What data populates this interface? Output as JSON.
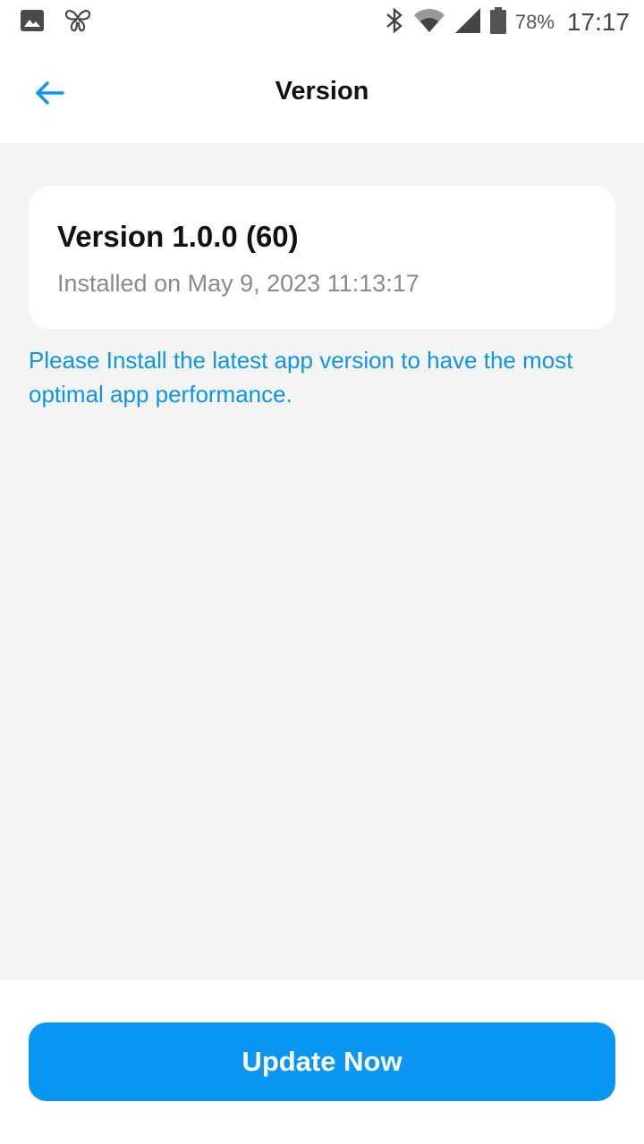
{
  "status_bar": {
    "icons_left": [
      "image-icon",
      "butterfly-icon"
    ],
    "icons_right": [
      "bluetooth-icon",
      "wifi-icon",
      "signal-icon",
      "battery-icon"
    ],
    "battery": "78%",
    "time": "17:17"
  },
  "header": {
    "title": "Version",
    "back_icon": "arrow-left-icon"
  },
  "version_card": {
    "title": "Version 1.0.0 (60)",
    "installed": "Installed on May 9, 2023 11:13:17"
  },
  "notice": "Please Install the latest app version to have the most optimal app performance.",
  "footer": {
    "update_label": "Update Now"
  },
  "colors": {
    "accent": "#0a97f3",
    "notice_text": "#0b96e8",
    "background": "#f4f4f4"
  }
}
